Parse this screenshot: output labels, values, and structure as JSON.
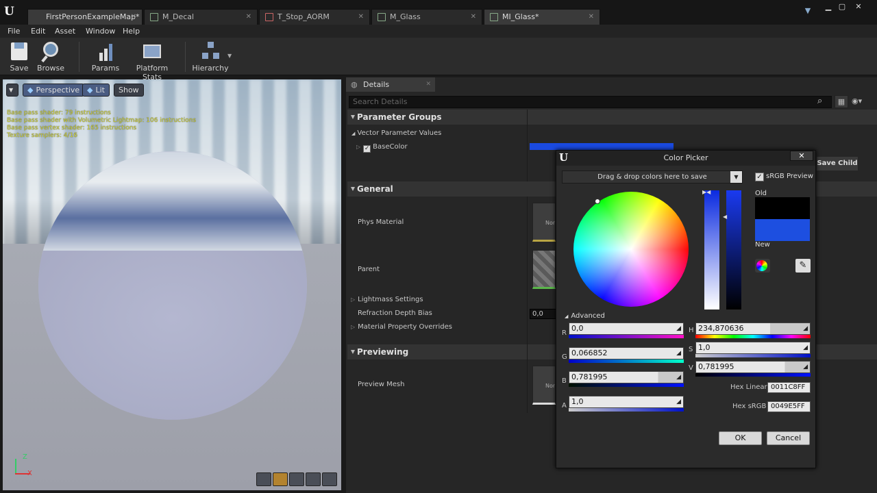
{
  "tabs": [
    {
      "label": "FirstPersonExampleMap*"
    },
    {
      "label": "M_Decal"
    },
    {
      "label": "T_Stop_AORM"
    },
    {
      "label": "M_Glass"
    },
    {
      "label": "MI_Glass*"
    }
  ],
  "menu": [
    "File",
    "Edit",
    "Asset",
    "Window",
    "Help"
  ],
  "toolbar": {
    "save": "Save",
    "browse": "Browse",
    "params": "Params",
    "platform_stats": "Platform Stats",
    "hierarchy": "Hierarchy"
  },
  "viewport": {
    "perspective": "Perspective",
    "lit": "Lit",
    "show": "Show",
    "stats": [
      "Base pass shader: 79 instructions",
      "Base pass shader with Volumetric Lightmap: 106 instructions",
      "Base pass vertex shader: 165 instructions",
      "Texture samplers: 4/16"
    ],
    "axis_z": "Z",
    "axis_x": "X"
  },
  "details": {
    "tab": "Details",
    "search_placeholder": "Search Details",
    "parameter_groups": "Parameter Groups",
    "vector_parameter_values": "Vector Parameter Values",
    "base_color": "BaseColor",
    "general": "General",
    "phys_material": "Phys Material",
    "parent": "Parent",
    "save_child": "Save Child",
    "lightmass_settings": "Lightmass Settings",
    "refraction_depth_bias": "Refraction Depth Bias",
    "refraction_value": "0,0",
    "material_property_overrides": "Material Property Overrides",
    "previewing": "Previewing",
    "preview_mesh": "Preview Mesh",
    "none": "Non"
  },
  "picker": {
    "title": "Color Picker",
    "drag_drop": "Drag & drop colors here to save",
    "srgb_preview": "sRGB Preview",
    "old": "Old",
    "new": "New",
    "advanced": "Advanced",
    "r_label": "R",
    "g_label": "G",
    "b_label": "B",
    "a_label": "A",
    "r": "0,0",
    "g": "0,066852",
    "b": "0,781995",
    "a": "1,0",
    "h_label": "H",
    "s_label": "S",
    "v_label": "V",
    "h": "234,870636",
    "s": "1,0",
    "v": "0,781995",
    "hex_linear_label": "Hex Linear",
    "hex_linear": "0011C8FF",
    "hex_srgb_label": "Hex sRGB",
    "hex_srgb": "0049E5FF",
    "ok": "OK",
    "cancel": "Cancel"
  },
  "colors": {
    "new_color": "#0049E5",
    "old_color": "#000000",
    "accent": "#1d4fe0"
  }
}
